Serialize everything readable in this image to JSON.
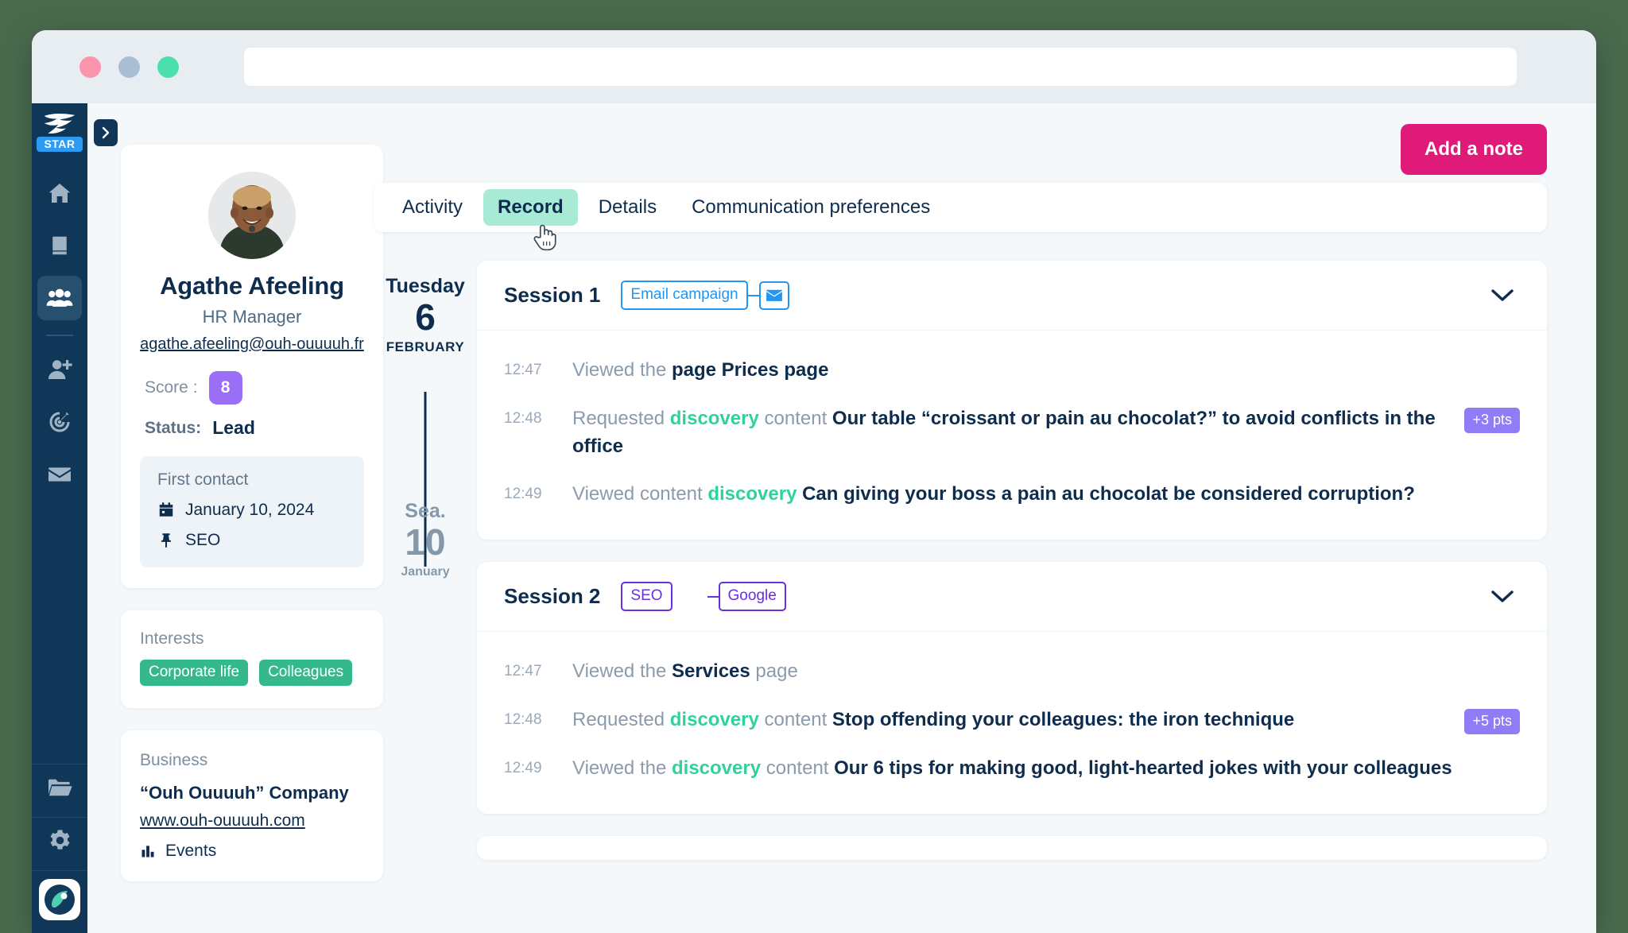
{
  "window": {
    "dots": [
      "close",
      "minimize",
      "maximize"
    ],
    "url_value": "",
    "url_placeholder": ""
  },
  "rail": {
    "logo_name": "app-logo-bird",
    "plan_badge": "STAR",
    "collapse_icon": "chevron-right-icon",
    "items": [
      {
        "name": "home-icon",
        "label": "Home"
      },
      {
        "name": "book-icon",
        "label": "Library"
      },
      {
        "name": "contacts-icon",
        "label": "Contacts"
      },
      {
        "name": "add-user-icon",
        "label": "Add contact"
      },
      {
        "name": "target-icon",
        "label": "Campaigns"
      },
      {
        "name": "envelope-icon",
        "label": "Emails"
      },
      {
        "name": "folder-icon",
        "label": "Files"
      },
      {
        "name": "gear-icon",
        "label": "Settings"
      }
    ],
    "account_avatar": "account-avatar"
  },
  "profile": {
    "avatar_alt": "Agathe Afeeling portrait",
    "name": "Agathe Afeeling",
    "role": "HR Manager",
    "email": "agathe.afeeling@ouh-ouuuuh.fr",
    "score_label": "Score :",
    "score_value": "8",
    "status_label": "Status:",
    "status_value": "Lead",
    "first_contact": {
      "title": "First contact",
      "date_icon": "calendar-icon",
      "date": "January 10, 2024",
      "source_icon": "pin-icon",
      "source": "SEO"
    },
    "interests": {
      "title": "Interests",
      "tags": [
        "Corporate life",
        "Colleagues"
      ]
    },
    "business": {
      "title": "Business",
      "company": "“Ouh Ouuuuh” Company",
      "website": "www.ouh-ouuuuh.com",
      "sector_icon": "chart-icon",
      "sector": "Events"
    }
  },
  "toolbar": {
    "add_note_label": "Add a note"
  },
  "tabs": [
    {
      "label": "Activity",
      "active": false
    },
    {
      "label": "Record",
      "active": true
    },
    {
      "label": "Details",
      "active": false
    },
    {
      "label": "Communication preferences",
      "active": false
    }
  ],
  "cursor": {
    "icon": "pointing-hand-cursor"
  },
  "timeline": [
    {
      "date": {
        "dow": "Tuesday",
        "day": "6",
        "month": "FEBRUARY",
        "muted": false
      },
      "session": {
        "title": "Session 1",
        "source_chip": "Email campaign",
        "source_color": "#2196f3",
        "channel_icon": "envelope-icon",
        "chevron_icon": "chevron-down-icon",
        "events": [
          {
            "time": "12:47",
            "parts": [
              {
                "t": "Viewed the ",
                "s": "muted"
              },
              {
                "t": "page Prices page",
                "s": "bold"
              }
            ],
            "points": ""
          },
          {
            "time": "12:48",
            "parts": [
              {
                "t": "Requested ",
                "s": "muted"
              },
              {
                "t": "discovery",
                "s": "green"
              },
              {
                "t": " content ",
                "s": "muted"
              },
              {
                "t": "Our table “croissant or pain au chocolat?” to avoid conflicts in the office",
                "s": "bold"
              }
            ],
            "points": "+3 pts"
          },
          {
            "time": "12:49",
            "parts": [
              {
                "t": "Viewed content ",
                "s": "muted"
              },
              {
                "t": "discovery",
                "s": "green"
              },
              {
                "t": " Can giving your boss a pain au chocolat be considered corruption?",
                "s": "bold"
              }
            ],
            "points": ""
          }
        ]
      }
    },
    {
      "date": {
        "dow": "Sea.",
        "day": "10",
        "month": "January",
        "muted": true
      },
      "session": {
        "title": "Session 2",
        "source_chip": "SEO",
        "source_color": "#6a2fe0",
        "channel_chip": "Google",
        "chevron_icon": "chevron-down-icon",
        "events": [
          {
            "time": "12:47",
            "parts": [
              {
                "t": "Viewed the ",
                "s": "muted"
              },
              {
                "t": "Services",
                "s": "bold"
              },
              {
                "t": " page",
                "s": "muted"
              }
            ],
            "points": ""
          },
          {
            "time": "12:48",
            "parts": [
              {
                "t": "Requested ",
                "s": "muted"
              },
              {
                "t": "discovery",
                "s": "green"
              },
              {
                "t": " content ",
                "s": "muted"
              },
              {
                "t": "Stop offending your colleagues: the iron technique",
                "s": "bold"
              }
            ],
            "points": "+5 pts"
          },
          {
            "time": "12:49",
            "parts": [
              {
                "t": "Viewed the ",
                "s": "muted"
              },
              {
                "t": "discovery",
                "s": "green"
              },
              {
                "t": " content ",
                "s": "muted"
              },
              {
                "t": "Our 6 tips for making good, light-hearted jokes with your colleagues",
                "s": "bold"
              }
            ],
            "points": ""
          }
        ]
      }
    }
  ],
  "colors": {
    "accent_pink": "#e01a78",
    "rail_navy": "#103658",
    "tab_active_bg": "#a9ead6",
    "green_tag": "#35b88c",
    "score_purple": "#9a6ef5",
    "points_purple": "#8f7cf7",
    "blue_chip": "#2196f3",
    "purple_chip": "#6a2fe0"
  }
}
